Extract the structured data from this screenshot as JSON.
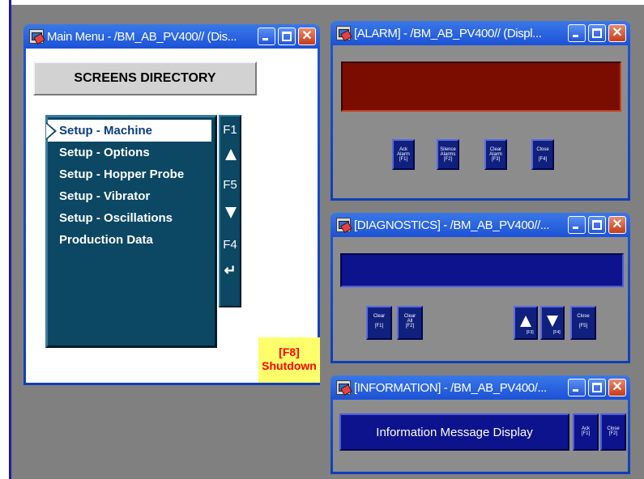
{
  "colors": {
    "desktop": "#808080",
    "titlebar": "#1c52d6",
    "alarm_display": "#7a0d00",
    "list_bg": "#0c4763",
    "shutdown_bg": "#ffff6c",
    "shutdown_text": "#ff0000"
  },
  "main_menu": {
    "title": "Main Menu - /BM_AB_PV400// (Dis...",
    "screens_directory": "SCREENS DIRECTORY",
    "items": [
      {
        "label": "Setup - Machine",
        "selected": true
      },
      {
        "label": "Setup - Options"
      },
      {
        "label": "Setup - Hopper Probe"
      },
      {
        "label": "Setup - Vibrator"
      },
      {
        "label": "Setup - Oscillations"
      },
      {
        "label": "Production Data"
      }
    ],
    "fkeys": {
      "f1": "F1",
      "up_icon": "arrow-up-icon",
      "f5": "F5",
      "down_icon": "arrow-down-icon",
      "f4": "F4",
      "enter_icon": "enter-icon"
    },
    "shutdown": {
      "key": "[F8]",
      "label": "Shutdown"
    }
  },
  "alarm": {
    "title": "[ALARM] - /BM_AB_PV400// (Displ...",
    "buttons": [
      {
        "label": "Ack\nAlarm\n[F1]"
      },
      {
        "label": "Silence\nAlarms\n[F2]"
      },
      {
        "label": "Clear\nAlarm\n[F3]"
      },
      {
        "label": "Close\n\n[F4]"
      }
    ]
  },
  "diagnostics": {
    "title": "[DIAGNOSTICS] - /BM_AB_PV400//...",
    "buttons": [
      {
        "label": "Clear\n\n[F1]"
      },
      {
        "label": "Clear\nAll\n[F2]"
      },
      {
        "label": "[F3]"
      },
      {
        "label": "[F4]"
      },
      {
        "label": "Close\n\n[F5]"
      }
    ]
  },
  "information": {
    "title": "[INFORMATION] - /BM_AB_PV400/...",
    "message": "Information Message Display",
    "buttons": [
      {
        "label": "Ack\n[F1]"
      },
      {
        "label": "Close\n[F2]"
      }
    ]
  }
}
